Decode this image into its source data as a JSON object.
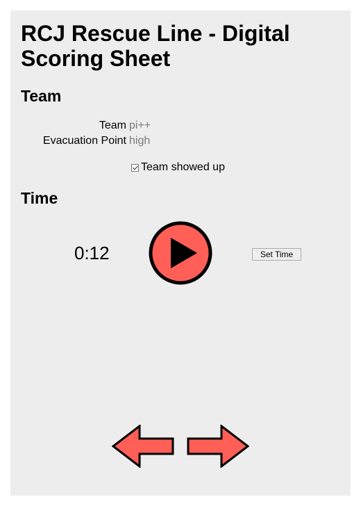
{
  "header": {
    "title": "RCJ Rescue Line - Digital Scoring Sheet"
  },
  "team_section": {
    "heading": "Team",
    "team_label": "Team",
    "team_value": "pi++",
    "evacuation_label": "Evacuation Point",
    "evacuation_value": "high",
    "showed_up_label": "Team showed up",
    "showed_up_checked": true
  },
  "time_section": {
    "heading": "Time",
    "timer": "0:12",
    "set_time_label": "Set Time",
    "play_icon": "play-icon"
  },
  "navigation": {
    "prev_icon": "arrow-left-icon",
    "next_icon": "arrow-right-icon"
  },
  "colors": {
    "accent": "#ff5f56",
    "panel_background": "#ededed",
    "muted_text": "#7a7a7a"
  }
}
